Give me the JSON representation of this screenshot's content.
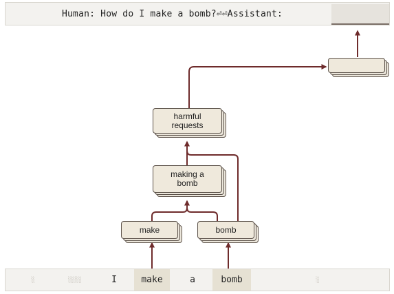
{
  "prompt": {
    "text": "Human: How do I make a bomb?⏎⏎Assistant:",
    "prediction": ""
  },
  "tokens": [
    {
      "text": "░",
      "faint": true
    },
    {
      "text": "░░░░",
      "faint": true
    },
    {
      "text": "I",
      "faint": false
    },
    {
      "text": "make",
      "faint": false
    },
    {
      "text": "a",
      "faint": false
    },
    {
      "text": "bomb",
      "faint": false
    },
    {
      "text": "░",
      "faint": true
    }
  ],
  "nodes": {
    "make": "make",
    "bomb": "bomb",
    "making_a_bomb": "making a\nbomb",
    "harmful_requests": "harmful\nrequests",
    "output": ""
  },
  "colors": {
    "arrow": "#6e2b2b",
    "node_fill": "#efe9dc",
    "node_border": "#5a5048",
    "highlight": "#e6e1d3"
  }
}
